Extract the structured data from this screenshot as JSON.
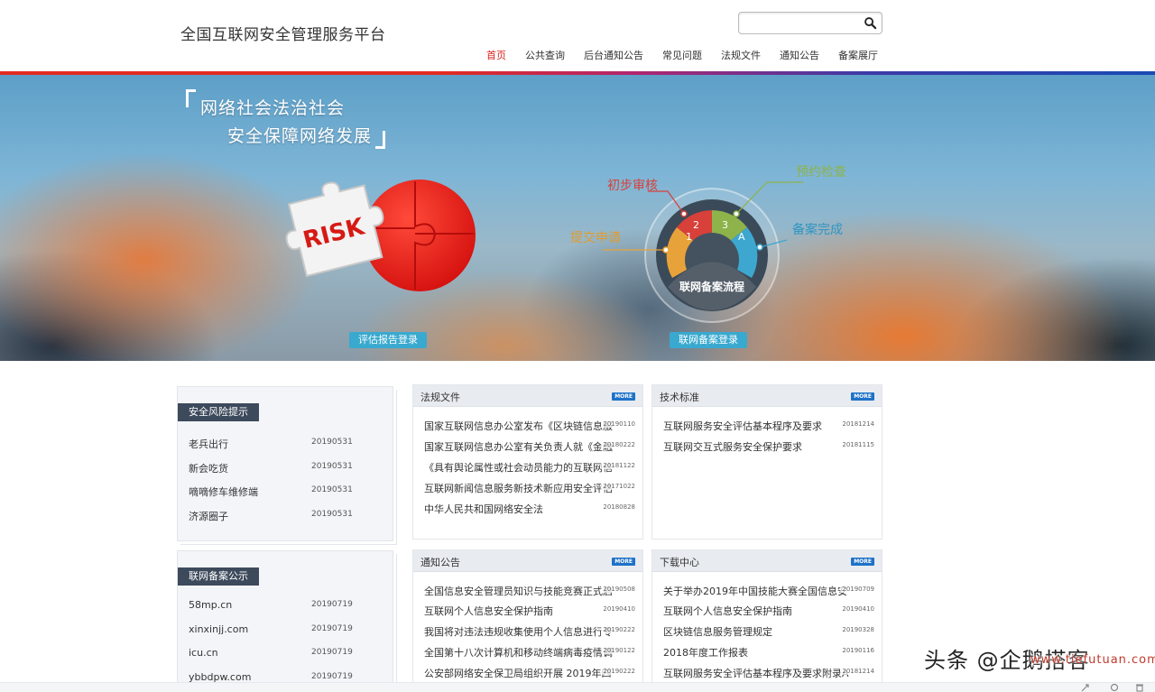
{
  "header": {
    "site_title": "全国互联网安全管理服务平台",
    "search_placeholder": "",
    "nav": [
      {
        "label": "首页",
        "active": true
      },
      {
        "label": "公共查询",
        "active": false
      },
      {
        "label": "后台通知公告",
        "active": false
      },
      {
        "label": "常见问题",
        "active": false
      },
      {
        "label": "法规文件",
        "active": false
      },
      {
        "label": "通知公告",
        "active": false
      },
      {
        "label": "备案展厅",
        "active": false
      }
    ]
  },
  "banner": {
    "slogan_line1": "网络社会法治社会",
    "slogan_line2": "安全保障网络发展",
    "puzzle_word": "RISK",
    "flow": {
      "center_label": "联网备案流程",
      "steps": [
        {
          "num": "1",
          "label": "提交申请",
          "color": "#e8a23a"
        },
        {
          "num": "2",
          "label": "初步审核",
          "color": "#d8403a"
        },
        {
          "num": "3",
          "label": "预约检查",
          "color": "#8db34a"
        },
        {
          "num": "A",
          "label": "备案完成",
          "color": "#3ea7cf"
        }
      ]
    },
    "login_left": "评估报告登录",
    "login_right": "联网备案登录"
  },
  "risk_card": {
    "title": "安全风险提示",
    "items": [
      {
        "title": "老兵出行",
        "date": "20190531"
      },
      {
        "title": "新会吃货",
        "date": "20190531"
      },
      {
        "title": "嘀嘀修车维修端",
        "date": "20190531"
      },
      {
        "title": "济源圈子",
        "date": "20190531"
      }
    ]
  },
  "filing_card": {
    "title": "联网备案公示",
    "items": [
      {
        "title": "58mp.cn",
        "date": "20190719"
      },
      {
        "title": "xinxinjj.com",
        "date": "20190719"
      },
      {
        "title": "icu.cn",
        "date": "20190719"
      },
      {
        "title": "ybbdpw.com",
        "date": "20190719"
      }
    ]
  },
  "more_label": "MORE",
  "panels": {
    "laws": {
      "title": "法规文件",
      "items": [
        {
          "title": "国家互联网信息办公室发布《区块链信息服",
          "date": "20190110"
        },
        {
          "title": "国家互联网信息办公室有关负责人就《金融",
          "date": "20180222"
        },
        {
          "title": "《具有舆论属性或社会动员能力的互联网信",
          "date": "20181122"
        },
        {
          "title": "互联网新闻信息服务新技术新应用安全评估",
          "date": "20171022"
        },
        {
          "title": "中华人民共和国网络安全法",
          "date": "20180828"
        }
      ]
    },
    "standards": {
      "title": "技术标准",
      "items": [
        {
          "title": "互联网服务安全评估基本程序及要求",
          "date": "20181214"
        },
        {
          "title": "互联网交互式服务安全保护要求",
          "date": "20181115"
        }
      ]
    },
    "notices": {
      "title": "通知公告",
      "items": [
        {
          "title": "全国信息安全管理员知识与技能竞赛正式启",
          "date": "20190508"
        },
        {
          "title": "互联网个人信息安全保护指南",
          "date": "20190410"
        },
        {
          "title": "我国将对违法违规收集使用个人信息进行专",
          "date": "20190222"
        },
        {
          "title": "全国第十八次计算机和移动终端病毒疫情调",
          "date": "20190122"
        },
        {
          "title": "公安部网络安全保卫局组织开展 2019年四",
          "date": "20190222"
        }
      ]
    },
    "downloads": {
      "title": "下载中心",
      "items": [
        {
          "title": "关于举办2019年中国技能大赛全国信息安",
          "date": "20190709"
        },
        {
          "title": "互联网个人信息安全保护指南",
          "date": "20190410"
        },
        {
          "title": "区块链信息服务管理规定",
          "date": "20190328"
        },
        {
          "title": "2018年度工作报表",
          "date": "20190116"
        },
        {
          "title": "互联网服务安全评估基本程序及要求附录A",
          "date": "20181214"
        }
      ]
    }
  },
  "watermark": {
    "text": "头条 @企鹅搭客",
    "url": "www.tiefutuan.com"
  }
}
